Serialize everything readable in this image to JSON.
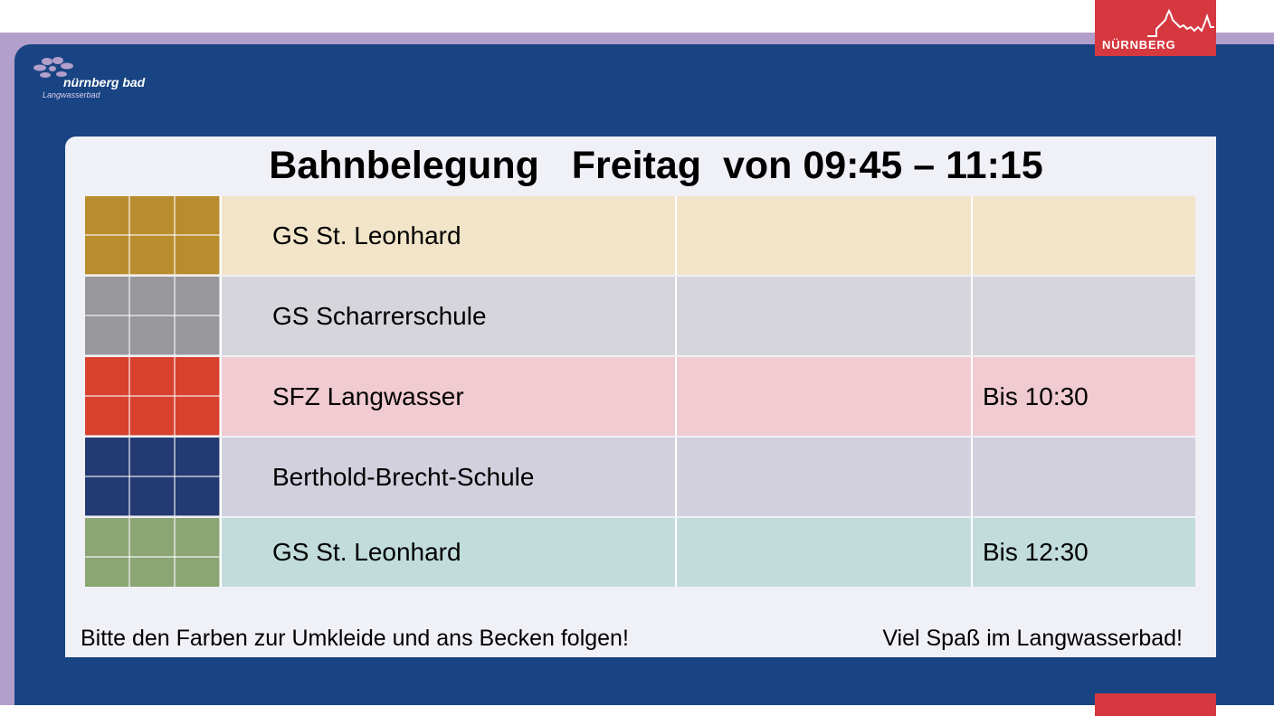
{
  "city_logo": {
    "text": "NÜRNBERG"
  },
  "bad_logo": {
    "name": "nürnberg bad",
    "subtitle": "Langwasserbad"
  },
  "board": {
    "title": "Bahnbelegung   Freitag  von 09:45 – 11:15",
    "rows": [
      {
        "name": "GS St. Leonhard",
        "note": "",
        "tile_color": "#b98c2e",
        "row_color": "#f1e4c9"
      },
      {
        "name": "GS Scharrerschule",
        "note": "",
        "tile_color": "#97979c",
        "row_color": "#d6d5dc"
      },
      {
        "name": "SFZ Langwasser",
        "note": "Bis 10:30",
        "tile_color": "#d8412e",
        "row_color": "#f0cbd1"
      },
      {
        "name": "Berthold-Brecht-Schule",
        "note": "",
        "tile_color": "#243a72",
        "row_color": "#d3d0de"
      },
      {
        "name": "GS St. Leonhard",
        "note": "Bis 12:30",
        "tile_color": "#8ba574",
        "row_color": "#c1dcdb"
      }
    ],
    "footer_left": "Bitte den Farben zur Umkleide und ans Becken folgen!",
    "footer_right": "Viel Spaß im Langwasserbad!"
  },
  "colors": {
    "navy": "#184483",
    "lilac": "#b39fcb",
    "city_red": "#d63840",
    "board_bg": "#f0f0f7"
  }
}
